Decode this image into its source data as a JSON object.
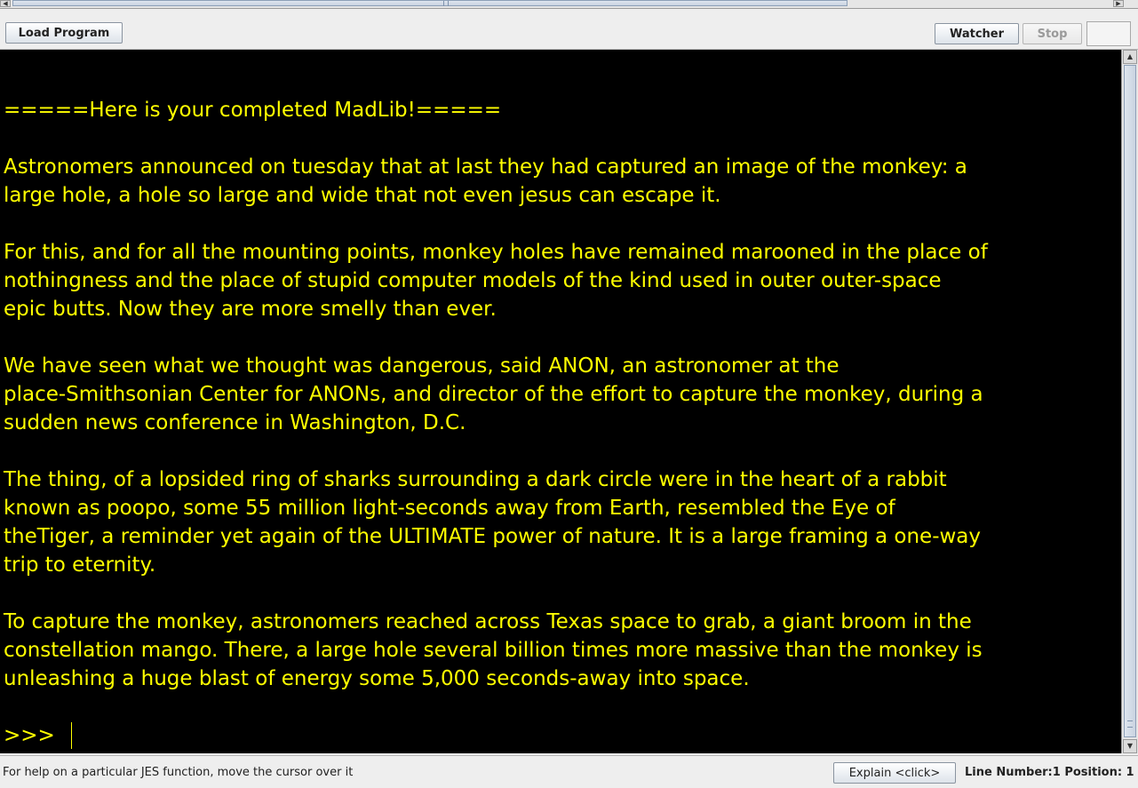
{
  "toolbar": {
    "load_label": "Load Program",
    "watcher_label": "Watcher",
    "stop_label": "Stop"
  },
  "console": {
    "header": "=====Here is your completed MadLib!=====",
    "paragraphs": [
      [
        "Astronomers announced on tuesday that at last they had captured an image of the monkey: a",
        "large hole, a hole so large and wide that not even jesus can escape it."
      ],
      [
        "For this, and for all the mounting points, monkey holes have remained marooned in the place of",
        "nothingness and the place of stupid computer models of the kind used in outer outer-space",
        "epic butts. Now they are more smelly than ever."
      ],
      [
        "We have seen what we thought was dangerous, said ANON, an astronomer at the",
        "place-Smithsonian Center for ANONs, and director of the effort to capture the monkey, during a",
        "sudden news conference in Washington, D.C."
      ],
      [
        "The thing, of a lopsided ring of sharks surrounding a dark circle were in the heart of a rabbit",
        "known as poopo, some 55 million light-seconds away from Earth, resembled the Eye of",
        "theTiger, a reminder yet again of the ULTIMATE power of nature. It is a large framing a one-way",
        "trip to eternity."
      ],
      [
        "To capture the monkey, astronomers reached across Texas space to grab, a giant broom in the",
        "constellation mango. There, a large hole several billion times more massive than the monkey is",
        "unleashing a huge blast of energy some 5,000 seconds-away into space."
      ]
    ],
    "prompt": ">>>"
  },
  "status": {
    "help": "For help on a particular JES function, move the cursor over it",
    "explain_label": "Explain <click>",
    "line_info": "Line Number:1 Position: 1"
  },
  "colors": {
    "console_bg": "#000000",
    "console_text": "#ffff00"
  }
}
